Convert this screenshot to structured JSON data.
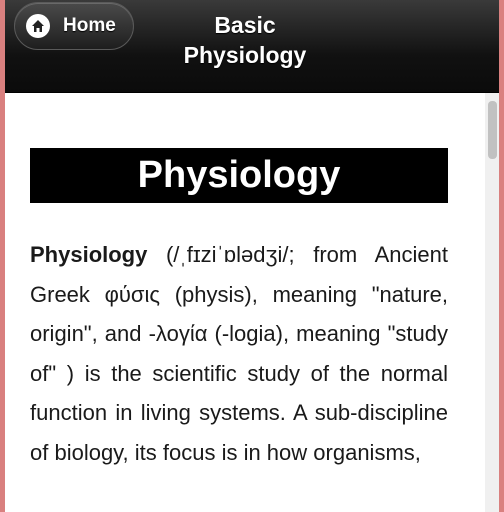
{
  "header": {
    "home_label": "Home",
    "title": "Basic Physiology"
  },
  "content": {
    "heading": "Physiology",
    "paragraph_term": "Physiology",
    "paragraph_rest": " (/ˌfɪziˈɒlədʒi/; from Ancient Greek φύσις (physis), meaning \"nature, origin\", and -λογία (-logia), meaning \"study of\" ) is the scientific study of the normal function in living systems. A sub-discipline of biology, its focus is in how organisms,"
  },
  "icons": {
    "home": "home-icon"
  },
  "colors": {
    "header_bg": "#111111",
    "heading_bg": "#000000",
    "heading_text": "#ffffff",
    "window_border": "#d9807f"
  }
}
